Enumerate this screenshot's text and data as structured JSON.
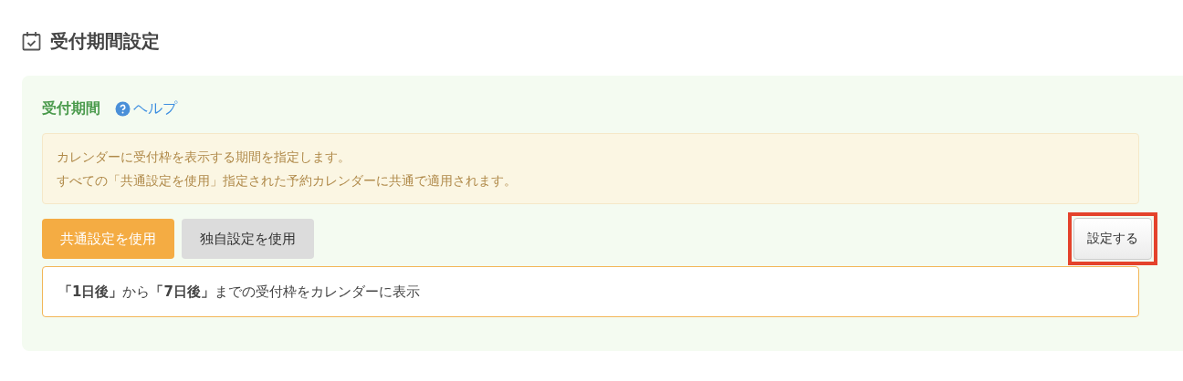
{
  "heading": {
    "title": "受付期間設定"
  },
  "section": {
    "title": "受付期間",
    "help_link": "ヘルプ",
    "notes": [
      "カレンダーに受付枠を表示する期間を指定します。",
      "すべての「共通設定を使用」指定された予約カレンダーに共通で適用されます。"
    ],
    "mode_buttons": [
      {
        "label": "共通設定を使用",
        "selected": true
      },
      {
        "label": "独自設定を使用",
        "selected": false
      }
    ],
    "set_button": {
      "label": "設定する",
      "highlighted": true
    },
    "summary": "**「1日後」**から**「7日後」**までの受付枠をカレンダーに表示"
  }
}
